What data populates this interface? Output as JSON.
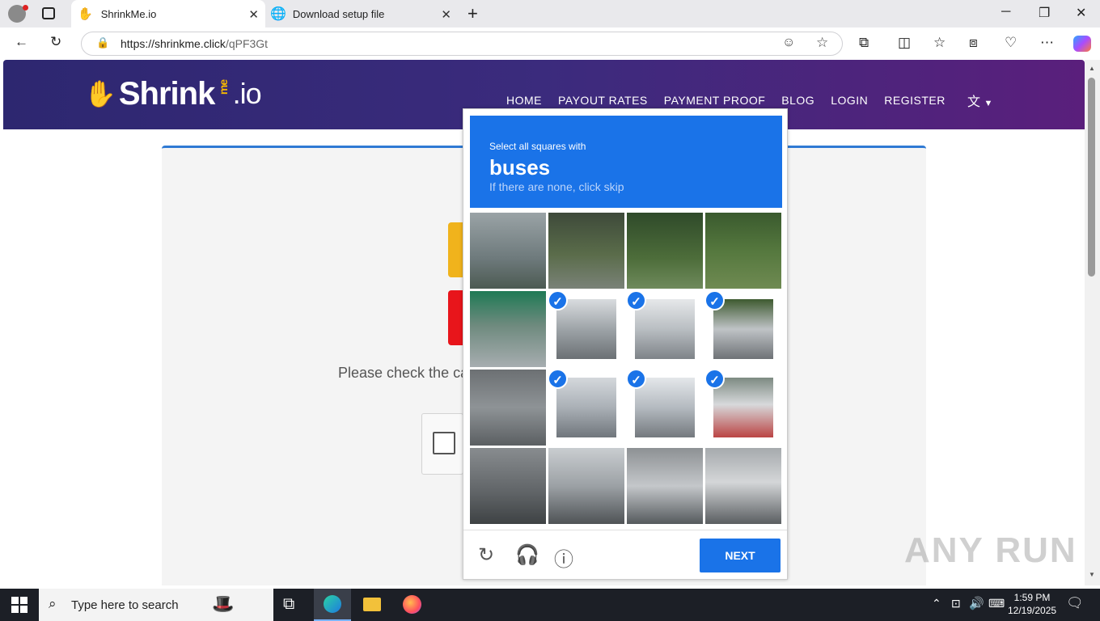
{
  "browser": {
    "tabs": [
      {
        "title": "ShrinkMe.io",
        "active": true
      },
      {
        "title": "Download setup file",
        "active": false
      }
    ],
    "url_host": "https://shrinkme.click",
    "url_path": "/qPF3Gt"
  },
  "site": {
    "logo_main": "Shrink",
    "logo_me": "me",
    "logo_io": ".io",
    "nav": [
      "HOME",
      "PAYOUT RATES",
      "PAYMENT PROOF",
      "BLOG",
      "LOGIN",
      "REGISTER"
    ],
    "please_check": "Please check the ca"
  },
  "captcha": {
    "instruction": "Select all squares with",
    "target": "buses",
    "hint": "If there are none, click skip",
    "next": "NEXT",
    "selected": [
      5,
      6,
      7,
      9,
      10,
      11
    ],
    "accent": "#1a73e8"
  },
  "watermark": "ANY RUN",
  "taskbar": {
    "search": "Type here to search",
    "time": "1:59 PM",
    "date": "12/19/2025"
  }
}
